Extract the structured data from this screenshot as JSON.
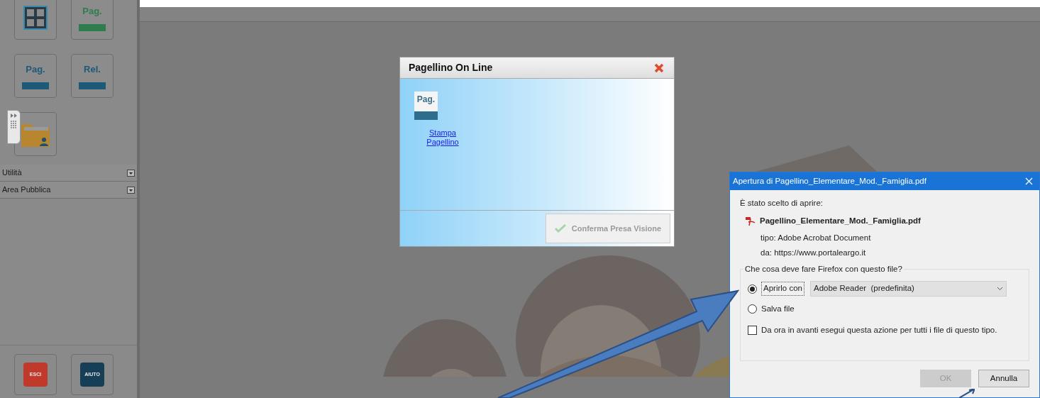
{
  "sidebar": {
    "tiles": [
      {
        "kind": "grid"
      },
      {
        "kind": "label",
        "label": "Pag.",
        "color": "#2e7d4f"
      },
      {
        "kind": "label",
        "label": "Pag.",
        "color": "#1d5a78"
      },
      {
        "kind": "label",
        "label": "Rel.",
        "color": "#1d5a78"
      },
      {
        "kind": "folder"
      }
    ],
    "sections": [
      {
        "label": "Utilità"
      },
      {
        "label": "Area Pubblica"
      }
    ],
    "bottom_buttons": [
      {
        "label": "ESCI",
        "color": "#c0392b"
      },
      {
        "label": "AIUTO",
        "color": "#163e56"
      }
    ]
  },
  "popup": {
    "title": "Pagellino On Line",
    "tile_label": "Pag.",
    "link": "Stampa Pagellino",
    "button": {
      "label": "Conferma Presa Visione",
      "disabled": true
    }
  },
  "download_dialog": {
    "title": "Apertura di Pagellino_Elementare_Mod._Famiglia.pdf",
    "intro": "È stato scelto di aprire:",
    "filename": "Pagellino_Elementare_Mod._Famiglia.pdf",
    "type_line": "tipo: Adobe Acrobat Document",
    "source_line": "da: https://www.portaleargo.it",
    "question": "Che cosa deve fare Firefox con questo file?",
    "options": [
      {
        "label": "Aprirlo con",
        "selected": true,
        "app": "Adobe Reader  (predefinita)"
      },
      {
        "label": "Salva file",
        "selected": false
      }
    ],
    "remember": {
      "label": "Da ora in avanti esegui questa azione per tutti i file di questo tipo.",
      "checked": false
    },
    "buttons": [
      {
        "label": "OK",
        "disabled": true
      },
      {
        "label": "Annulla",
        "disabled": false
      }
    ]
  }
}
